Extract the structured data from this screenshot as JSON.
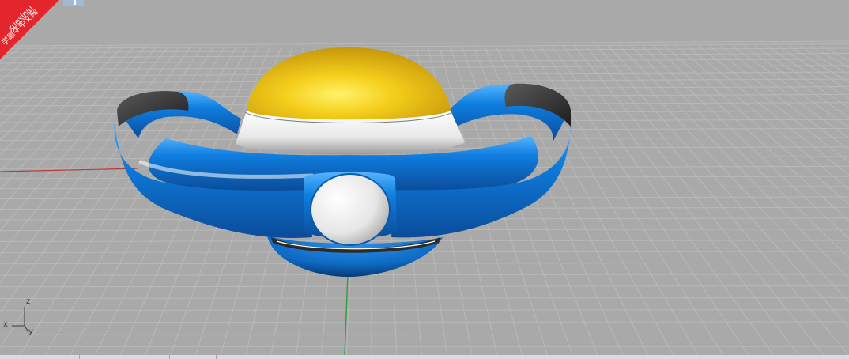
{
  "watermark": {
    "brand": "xuexiniu",
    "subtitle": "学犀牛中文网",
    "color": "#e4262c"
  },
  "viewport": {
    "background_color": "#a9a9a9",
    "grid_color": "#b9b9b9",
    "x_axis_color": "#b23b3b",
    "y_axis_color": "#2f9e3f"
  },
  "axis_widget": {
    "z_label": "z",
    "x_label": "x",
    "y_label": "y"
  },
  "model": {
    "body_color": "#1278d4",
    "dome_color": "#f2c40f",
    "ring_color": "#f2f2f2",
    "handle_tip_color": "#2b2b2b",
    "button_color": "#f0f0f0"
  }
}
